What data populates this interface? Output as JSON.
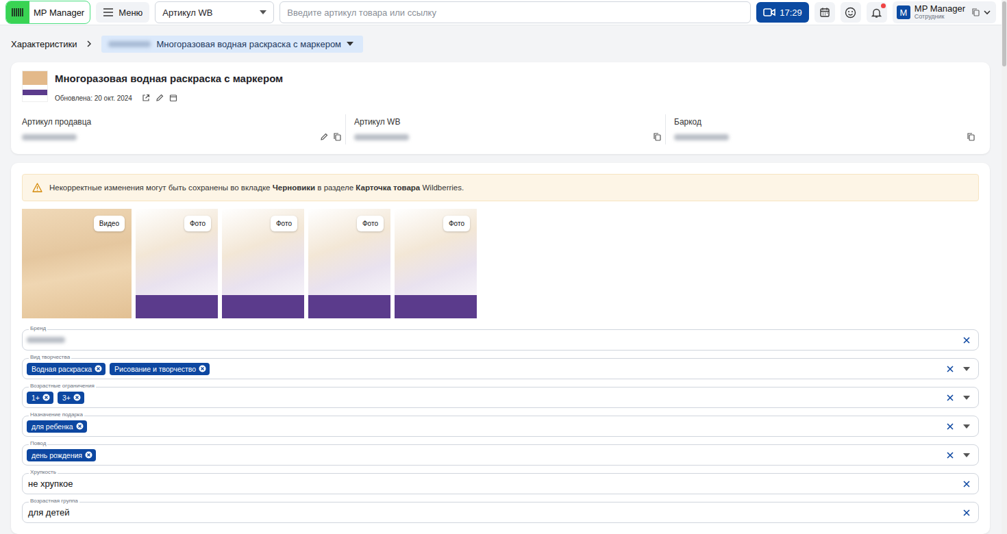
{
  "topbar": {
    "logo": "MP Manager",
    "menu": "Меню",
    "search_type": "Артикул WB",
    "search": {
      "placeholder": "Введите артикул товара или ссылку"
    },
    "timer": "17:29",
    "notifications": {
      "unread": true
    },
    "user": {
      "avatar": "M",
      "name": "MP Manager",
      "role": "Сотрудник"
    }
  },
  "breadcrumb": {
    "root": "Характеристики",
    "current": "Многоразовая водная раскраска с маркером"
  },
  "product": {
    "title": "Многоразовая водная раскраска с маркером",
    "updated": "Обновлена: 20 окт. 2024",
    "ids": [
      {
        "label": "Артикул продавца",
        "editable": true
      },
      {
        "label": "Артикул WB",
        "editable": false
      },
      {
        "label": "Баркод",
        "editable": false
      }
    ]
  },
  "notice": {
    "parts": [
      {
        "text": "Некорректные изменения могут быть сохранены во вкладке ",
        "bold": false
      },
      {
        "text": "Черновики",
        "bold": true
      },
      {
        "text": " в разделе ",
        "bold": false
      },
      {
        "text": "Карточка товара",
        "bold": true
      },
      {
        "text": " Wildberries.",
        "bold": false
      }
    ]
  },
  "media": [
    {
      "label": "Видео",
      "kind": "video"
    },
    {
      "label": "Фото",
      "kind": "photo"
    },
    {
      "label": "Фото",
      "kind": "photo"
    },
    {
      "label": "Фото",
      "kind": "photo"
    },
    {
      "label": "Фото",
      "kind": "photo"
    }
  ],
  "fields": [
    {
      "label": "Бренд",
      "kind": "hidden",
      "dropdown": false
    },
    {
      "label": "Вид творчества",
      "kind": "chips",
      "chips": [
        "Водная раскраска",
        "Рисование и творчество"
      ],
      "dropdown": true
    },
    {
      "label": "Возрастные ограничения",
      "kind": "chips",
      "chips": [
        "1+",
        "3+"
      ],
      "dropdown": true
    },
    {
      "label": "Назначение подарка",
      "kind": "chips",
      "chips": [
        "для ребенка"
      ],
      "dropdown": true
    },
    {
      "label": "Повод",
      "kind": "chips",
      "chips": [
        "день рождения"
      ],
      "dropdown": true
    },
    {
      "label": "Хрупкость",
      "kind": "text",
      "value": "не хрупкое",
      "dropdown": false
    },
    {
      "label": "Возрастная группа",
      "kind": "text",
      "value": "для детей",
      "dropdown": false
    }
  ]
}
